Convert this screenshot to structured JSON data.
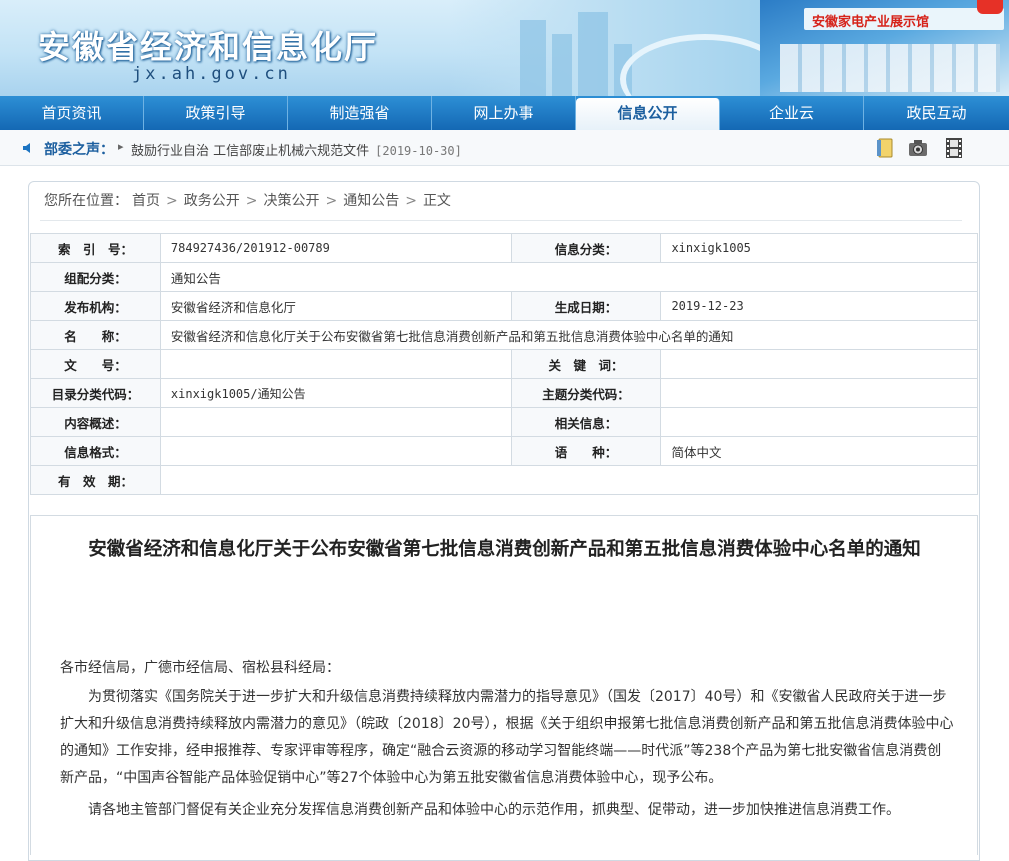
{
  "site": {
    "title": "安徽省经济和信息化厅",
    "domain": "jx.ah.gov.cn",
    "banner_sign": "安徽家电产业展示馆"
  },
  "nav": {
    "items": [
      {
        "label": "首页资讯",
        "active": false
      },
      {
        "label": "政策引导",
        "active": false
      },
      {
        "label": "制造强省",
        "active": false
      },
      {
        "label": "网上办事",
        "active": false
      },
      {
        "label": "信息公开",
        "active": true
      },
      {
        "label": "企业云",
        "active": false
      },
      {
        "label": "政民互动",
        "active": false
      }
    ]
  },
  "ticker": {
    "label": "部委之声：",
    "headline": "鼓励行业自治 工信部废止机械六规范文件",
    "date": "[2019-10-30]"
  },
  "breadcrumb": {
    "prefix": "您所在位置：",
    "items": [
      "首页",
      "政务公开",
      "决策公开",
      "通知公告",
      "正文"
    ]
  },
  "meta": {
    "index_no_label": "索　引　号：",
    "index_no": "784927436/201912-00789",
    "info_category_label": "信息分类：",
    "info_category": "xinxigk1005",
    "topic_label": "组配分类：",
    "topic": "通知公告",
    "publisher_label": "发布机构：",
    "publisher": "安徽省经济和信息化厅",
    "created_label": "生成日期：",
    "created": "2019-12-23",
    "name_label": "名　　称：",
    "name": "安徽省经济和信息化厅关于公布安徽省第七批信息消费创新产品和第五批信息消费体验中心名单的通知",
    "doc_no_label": "文　　号：",
    "doc_no": "",
    "keywords_label": "关　键　词：",
    "keywords": "",
    "catalog_code_label": "目录分类代码：",
    "catalog_code": "xinxigk1005/通知公告",
    "subject_code_label": "主题分类代码：",
    "subject_code": "",
    "summary_label": "内容概述：",
    "summary": "",
    "related_label": "相关信息：",
    "related": "",
    "format_label": "信息格式：",
    "format": "",
    "language_label": "语　　种：",
    "language": "简体中文",
    "validity_label": "有　效　期：",
    "validity": ""
  },
  "article": {
    "title": "安徽省经济和信息化厅关于公布安徽省第七批信息消费创新产品和第五批信息消费体验中心名单的通知",
    "salutation": "各市经信局，广德市经信局、宿松县科经局：",
    "para1": "为贯彻落实《国务院关于进一步扩大和升级信息消费持续释放内需潜力的指导意见》（国发〔2017〕40号）和《安徽省人民政府关于进一步扩大和升级信息消费持续释放内需潜力的意见》（皖政〔2018〕20号），根据《关于组织申报第七批信息消费创新产品和第五批信息消费体验中心的通知》工作安排，经申报推荐、专家评审等程序，确定“融合云资源的移动学习智能终端——时代派”等238个产品为第七批安徽省信息消费创新产品，“中国声谷智能产品体验促销中心”等27个体验中心为第五批安徽省信息消费体验中心，现予公布。",
    "para2": "请各地主管部门督促有关企业充分发挥信息消费创新产品和体验中心的示范作用，抓典型、促带动，进一步加快推进信息消费工作。"
  },
  "colors": {
    "nav_blue": "#1c74c2",
    "link_blue": "#1c5f9f",
    "border": "#d3dbe2"
  }
}
